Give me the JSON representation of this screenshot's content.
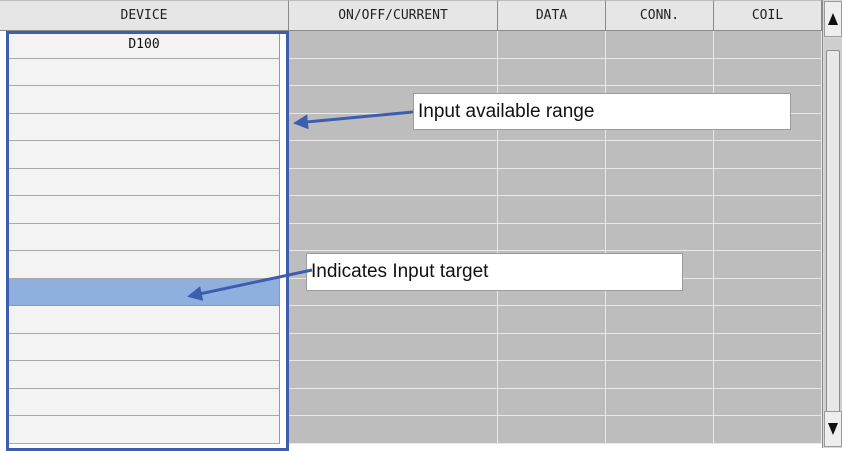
{
  "table": {
    "headers": {
      "device": "DEVICE",
      "on_off_current": "ON/OFF/CURRENT",
      "data": "DATA",
      "conn": "CONN.",
      "coil": "COIL"
    },
    "rows": [
      {
        "device": "D100"
      },
      {
        "device": ""
      },
      {
        "device": ""
      },
      {
        "device": ""
      },
      {
        "device": ""
      },
      {
        "device": ""
      },
      {
        "device": ""
      },
      {
        "device": ""
      },
      {
        "device": ""
      },
      {
        "device": "",
        "selected": true
      },
      {
        "device": ""
      },
      {
        "device": ""
      },
      {
        "device": ""
      },
      {
        "device": ""
      },
      {
        "device": ""
      }
    ]
  },
  "annotations": {
    "input_range": "Input available range",
    "input_target": "Indicates Input target"
  },
  "scrollbar": {
    "up_icon": "arrow-up-icon",
    "down_icon": "arrow-down-icon"
  },
  "colors": {
    "frame": "#3d5eaf",
    "selected_row": "#8fb0df",
    "grey_cell": "#bdbdbd"
  }
}
